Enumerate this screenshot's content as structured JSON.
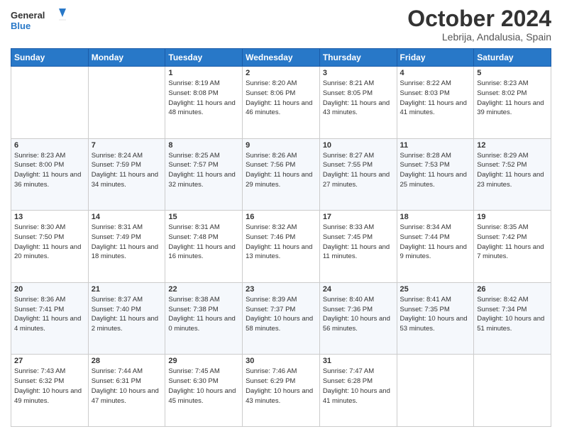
{
  "header": {
    "logo_general": "General",
    "logo_blue": "Blue",
    "month": "October 2024",
    "location": "Lebrija, Andalusia, Spain"
  },
  "days_of_week": [
    "Sunday",
    "Monday",
    "Tuesday",
    "Wednesday",
    "Thursday",
    "Friday",
    "Saturday"
  ],
  "weeks": [
    [
      {
        "day": "",
        "info": ""
      },
      {
        "day": "",
        "info": ""
      },
      {
        "day": "1",
        "info": "Sunrise: 8:19 AM\nSunset: 8:08 PM\nDaylight: 11 hours and 48 minutes."
      },
      {
        "day": "2",
        "info": "Sunrise: 8:20 AM\nSunset: 8:06 PM\nDaylight: 11 hours and 46 minutes."
      },
      {
        "day": "3",
        "info": "Sunrise: 8:21 AM\nSunset: 8:05 PM\nDaylight: 11 hours and 43 minutes."
      },
      {
        "day": "4",
        "info": "Sunrise: 8:22 AM\nSunset: 8:03 PM\nDaylight: 11 hours and 41 minutes."
      },
      {
        "day": "5",
        "info": "Sunrise: 8:23 AM\nSunset: 8:02 PM\nDaylight: 11 hours and 39 minutes."
      }
    ],
    [
      {
        "day": "6",
        "info": "Sunrise: 8:23 AM\nSunset: 8:00 PM\nDaylight: 11 hours and 36 minutes."
      },
      {
        "day": "7",
        "info": "Sunrise: 8:24 AM\nSunset: 7:59 PM\nDaylight: 11 hours and 34 minutes."
      },
      {
        "day": "8",
        "info": "Sunrise: 8:25 AM\nSunset: 7:57 PM\nDaylight: 11 hours and 32 minutes."
      },
      {
        "day": "9",
        "info": "Sunrise: 8:26 AM\nSunset: 7:56 PM\nDaylight: 11 hours and 29 minutes."
      },
      {
        "day": "10",
        "info": "Sunrise: 8:27 AM\nSunset: 7:55 PM\nDaylight: 11 hours and 27 minutes."
      },
      {
        "day": "11",
        "info": "Sunrise: 8:28 AM\nSunset: 7:53 PM\nDaylight: 11 hours and 25 minutes."
      },
      {
        "day": "12",
        "info": "Sunrise: 8:29 AM\nSunset: 7:52 PM\nDaylight: 11 hours and 23 minutes."
      }
    ],
    [
      {
        "day": "13",
        "info": "Sunrise: 8:30 AM\nSunset: 7:50 PM\nDaylight: 11 hours and 20 minutes."
      },
      {
        "day": "14",
        "info": "Sunrise: 8:31 AM\nSunset: 7:49 PM\nDaylight: 11 hours and 18 minutes."
      },
      {
        "day": "15",
        "info": "Sunrise: 8:31 AM\nSunset: 7:48 PM\nDaylight: 11 hours and 16 minutes."
      },
      {
        "day": "16",
        "info": "Sunrise: 8:32 AM\nSunset: 7:46 PM\nDaylight: 11 hours and 13 minutes."
      },
      {
        "day": "17",
        "info": "Sunrise: 8:33 AM\nSunset: 7:45 PM\nDaylight: 11 hours and 11 minutes."
      },
      {
        "day": "18",
        "info": "Sunrise: 8:34 AM\nSunset: 7:44 PM\nDaylight: 11 hours and 9 minutes."
      },
      {
        "day": "19",
        "info": "Sunrise: 8:35 AM\nSunset: 7:42 PM\nDaylight: 11 hours and 7 minutes."
      }
    ],
    [
      {
        "day": "20",
        "info": "Sunrise: 8:36 AM\nSunset: 7:41 PM\nDaylight: 11 hours and 4 minutes."
      },
      {
        "day": "21",
        "info": "Sunrise: 8:37 AM\nSunset: 7:40 PM\nDaylight: 11 hours and 2 minutes."
      },
      {
        "day": "22",
        "info": "Sunrise: 8:38 AM\nSunset: 7:38 PM\nDaylight: 11 hours and 0 minutes."
      },
      {
        "day": "23",
        "info": "Sunrise: 8:39 AM\nSunset: 7:37 PM\nDaylight: 10 hours and 58 minutes."
      },
      {
        "day": "24",
        "info": "Sunrise: 8:40 AM\nSunset: 7:36 PM\nDaylight: 10 hours and 56 minutes."
      },
      {
        "day": "25",
        "info": "Sunrise: 8:41 AM\nSunset: 7:35 PM\nDaylight: 10 hours and 53 minutes."
      },
      {
        "day": "26",
        "info": "Sunrise: 8:42 AM\nSunset: 7:34 PM\nDaylight: 10 hours and 51 minutes."
      }
    ],
    [
      {
        "day": "27",
        "info": "Sunrise: 7:43 AM\nSunset: 6:32 PM\nDaylight: 10 hours and 49 minutes."
      },
      {
        "day": "28",
        "info": "Sunrise: 7:44 AM\nSunset: 6:31 PM\nDaylight: 10 hours and 47 minutes."
      },
      {
        "day": "29",
        "info": "Sunrise: 7:45 AM\nSunset: 6:30 PM\nDaylight: 10 hours and 45 minutes."
      },
      {
        "day": "30",
        "info": "Sunrise: 7:46 AM\nSunset: 6:29 PM\nDaylight: 10 hours and 43 minutes."
      },
      {
        "day": "31",
        "info": "Sunrise: 7:47 AM\nSunset: 6:28 PM\nDaylight: 10 hours and 41 minutes."
      },
      {
        "day": "",
        "info": ""
      },
      {
        "day": "",
        "info": ""
      }
    ]
  ]
}
